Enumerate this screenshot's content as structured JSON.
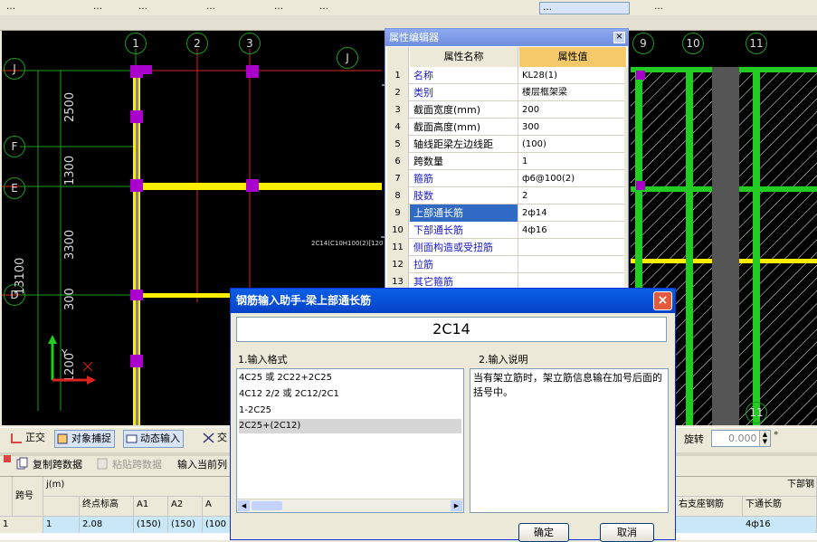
{
  "top_toolbar": {
    "items": [
      "…",
      "…",
      "…",
      "…",
      "…",
      "…",
      "…",
      "…"
    ]
  },
  "canvas": {
    "axis_top": [
      "1",
      "2",
      "3",
      "J",
      "9",
      "10",
      "11"
    ],
    "axis_left": [
      "J",
      "F",
      "E",
      "D"
    ],
    "dim_left": [
      "2500",
      "1300",
      "3300",
      "300",
      "1200"
    ],
    "dim_total": "13100",
    "beam_note": "2C14(C10H100(2)[120",
    "ucs_y": "Y",
    "colors": {
      "grid": "#dd2222",
      "beam_yellow": "#ffee00",
      "column_magenta": "#aa00cc",
      "wall_green": "#22cc22"
    }
  },
  "prop_editor": {
    "title": "属性编辑器",
    "col_name": "属性名称",
    "col_value": "属性值",
    "rows": [
      {
        "num": "1",
        "name": "名称",
        "value": "KL28(1)",
        "blue": true
      },
      {
        "num": "2",
        "name": "类别",
        "value": "楼层框架梁",
        "blue": true
      },
      {
        "num": "3",
        "name": "截面宽度(mm)",
        "value": "200",
        "blue": false
      },
      {
        "num": "4",
        "name": "截面高度(mm)",
        "value": "300",
        "blue": false
      },
      {
        "num": "5",
        "name": "轴线距梁左边线距",
        "value": "(100)",
        "blue": false
      },
      {
        "num": "6",
        "name": "跨数量",
        "value": "1",
        "blue": false
      },
      {
        "num": "7",
        "name": "箍筋",
        "value": "ф6@100(2)",
        "blue": true
      },
      {
        "num": "8",
        "name": "肢数",
        "value": "2",
        "blue": true
      },
      {
        "num": "9",
        "name": "上部通长筋",
        "value": "2ф14",
        "blue": true
      },
      {
        "num": "10",
        "name": "下部通长筋",
        "value": "4ф16",
        "blue": true
      },
      {
        "num": "11",
        "name": "侧面构造或受扭筋",
        "value": "",
        "blue": true
      },
      {
        "num": "12",
        "name": "拉筋",
        "value": "",
        "blue": true
      },
      {
        "num": "13",
        "name": "其它箍筋",
        "value": "",
        "blue": true
      }
    ]
  },
  "rebar_dialog": {
    "title": "钢筋输入助手-梁上部通长筋",
    "input_value": "2C14",
    "format_label": "1.输入格式",
    "desc_label": "2.输入说明",
    "formats": [
      "4C25 或 2C22+2C25",
      "4C12 2/2 或 2C12/2C1",
      "1-2C25",
      "2C25+(2C12)"
    ],
    "description": "当有架立筋时，架立筋信息输在加号后面的括号中。",
    "ok_label": "确定",
    "cancel_label": "取消"
  },
  "status_toolbar": {
    "ortho": "正交",
    "snap": "对象捕捉",
    "dynamic": "动态输入",
    "cross": "交",
    "rotate_label": "旋转",
    "rotate_value": "0.000",
    "degree": "°"
  },
  "grid_toolbar": {
    "copy": "复制跨数据",
    "paste": "粘贴跨数据",
    "input_current": "输入当前列"
  },
  "span_table": {
    "headers_top": [
      "j(m)",
      "下部钢"
    ],
    "headers": [
      "跨号",
      "终点标高",
      "A1",
      "A2",
      "A",
      "右支座钢筋",
      "下通长筋"
    ],
    "row": {
      "row_num": "1",
      "span": "1",
      "end_elev": "2.08",
      "a1": "(150)",
      "a2": "(150)",
      "a3": "(100",
      "right_support": "",
      "bottom_long": "4ф16"
    }
  }
}
